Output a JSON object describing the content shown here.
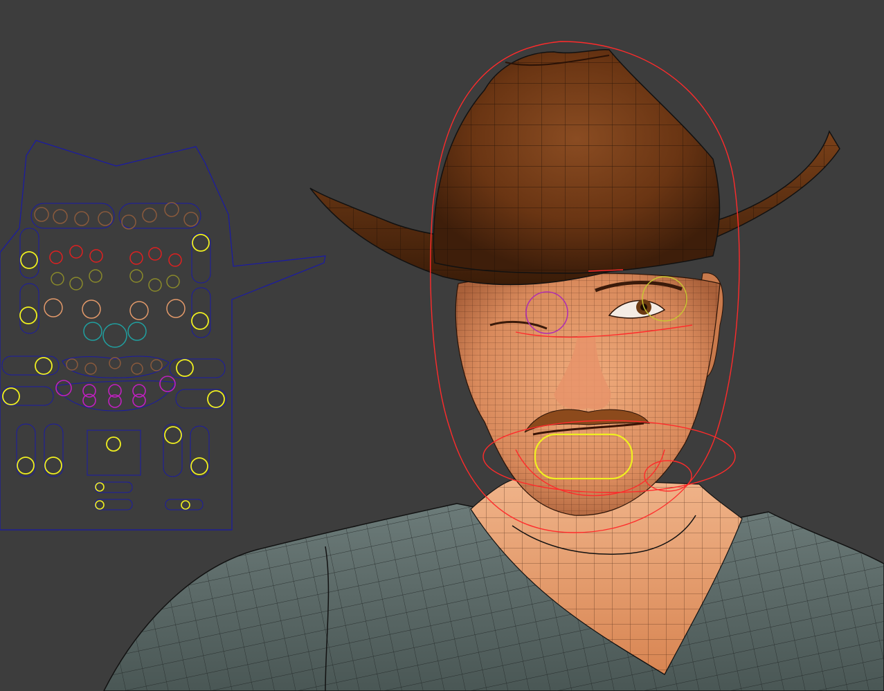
{
  "viewport": {
    "background": "#3d3d3d",
    "picker_outline_color": "#1a1aa6",
    "rig_curve_color": "#ff2b2b",
    "wire_color": "#111111"
  },
  "face_picker": {
    "panel_shape": "hat-silhouette",
    "controls": [
      {
        "name": "brow-l-ctrl",
        "color": "#8a5a3c"
      },
      {
        "name": "brow-r-ctrl",
        "color": "#8a5a3c"
      },
      {
        "name": "eye-upper-ctrl",
        "color": "#e02020"
      },
      {
        "name": "eye-lower-ctrl",
        "color": "#8a8a2a"
      },
      {
        "name": "cheek-ctrl",
        "color": "#e49a6a"
      },
      {
        "name": "nose-ctrl",
        "color": "#20a0a0"
      },
      {
        "name": "mouth-upper-ctrl",
        "color": "#8a5a3c"
      },
      {
        "name": "mouth-lower-ctrl",
        "color": "#c020c0"
      },
      {
        "name": "side-slider-ctrl",
        "color": "#f0f020"
      },
      {
        "name": "jaw-ctrl",
        "color": "#f0f020"
      }
    ]
  },
  "model": {
    "hat_color": "#6e3a17",
    "skin_color": "#e29a6c",
    "shirt_color": "#5f6e6c",
    "eye_ctrl_color": "#b030b0",
    "mouth_ctrl_color": "#f0f020"
  }
}
